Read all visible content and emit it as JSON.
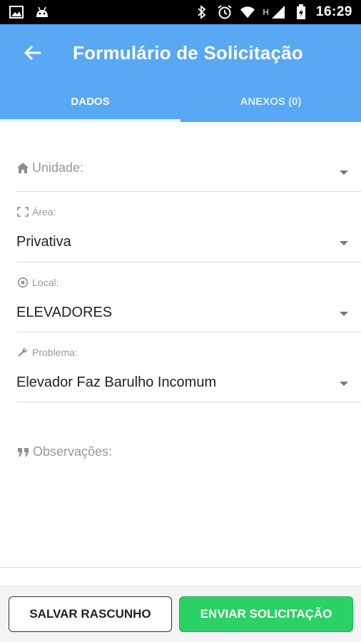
{
  "statusbar": {
    "time": "16:29",
    "network_label": "H",
    "icons": [
      "image-icon",
      "android-icon",
      "bluetooth-icon",
      "alarm-icon",
      "wifi-icon",
      "signal-icon",
      "battery-icon"
    ]
  },
  "appbar": {
    "title": "Formulário de Solicitação",
    "back_icon": "arrow-left-icon",
    "background": "#58a8f4"
  },
  "tabs": [
    {
      "label": "DADOS",
      "active": true
    },
    {
      "label": "ANEXOS (0)",
      "active": false
    }
  ],
  "form": {
    "unidade": {
      "label": "Unidade:",
      "icon": "home-icon",
      "value": ""
    },
    "area": {
      "label": "Área:",
      "icon": "expand-icon",
      "value": "Privativa"
    },
    "local": {
      "label": "Local:",
      "icon": "location-icon",
      "value": "ELEVADORES"
    },
    "problema": {
      "label": "Problema:",
      "icon": "wrench-icon",
      "value": "Elevador Faz Barulho Incomum"
    },
    "observacoes": {
      "label": "Observações:",
      "icon": "quote-icon"
    }
  },
  "actions": {
    "save_draft": "SALVAR RASCUNHO",
    "send": "ENVIAR SOLICITAÇÃO",
    "send_color": "#2ad164"
  }
}
